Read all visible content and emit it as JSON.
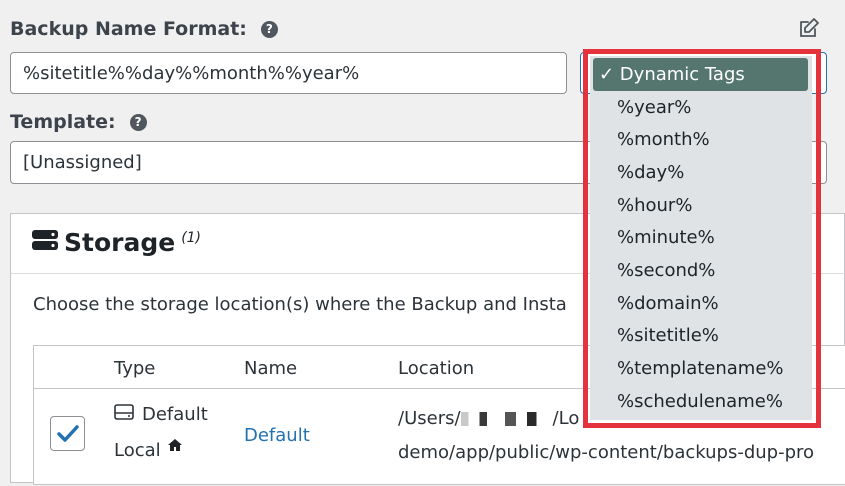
{
  "backup_name": {
    "label": "Backup Name Format:",
    "help": "?",
    "value": "%sitetitle%%day%%month%%year%"
  },
  "template": {
    "label": "Template:",
    "help": "?",
    "value": "[Unassigned]"
  },
  "storage": {
    "title": "Storage",
    "count": "(1)",
    "description": "Choose the storage location(s) where the Backup and Insta",
    "table": {
      "headers": [
        "Type",
        "Name",
        "Location"
      ],
      "rows": [
        {
          "checked": true,
          "type_line1": "Default",
          "type_line2": "Local",
          "name": "Default",
          "location_line1": "/Users/",
          "location_line1_end": "/Lo",
          "location_line2": "demo/app/public/wp-content/backups-dup-pro"
        }
      ]
    }
  },
  "dropdown": {
    "selected": "✓ Dynamic Tags",
    "options": [
      "%year%",
      "%month%",
      "%day%",
      "%hour%",
      "%minute%",
      "%second%",
      "%domain%",
      "%sitetitle%",
      "%templatename%",
      "%schedulename%"
    ]
  },
  "colors": {
    "accent": "#2271b1",
    "highlight_outline": "#e4333c",
    "selected_option": "#55766e"
  },
  "icons": {
    "edit": "edit-icon",
    "storage": "database-icon",
    "home": "home-icon",
    "check": "checkmark-icon"
  }
}
